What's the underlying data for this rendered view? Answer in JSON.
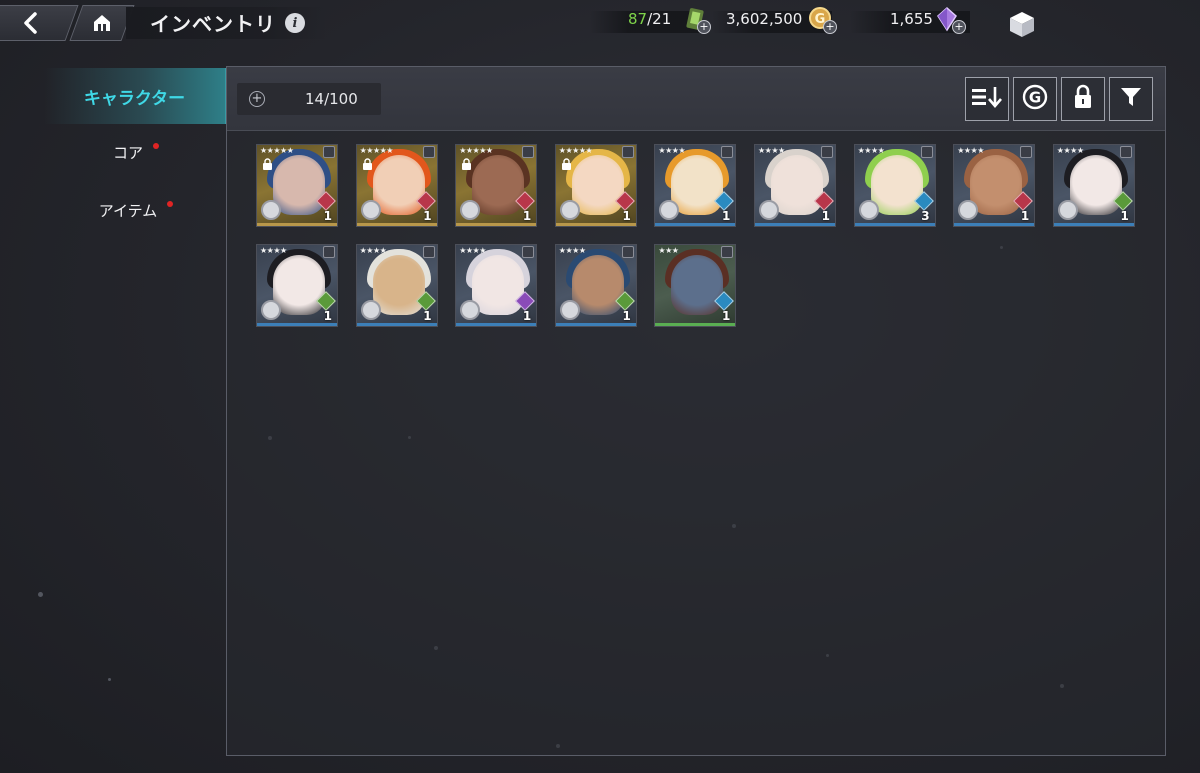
{
  "header": {
    "title": "インベントリ",
    "info_icon": "i",
    "stamina": {
      "current": "87",
      "max": "/21"
    },
    "gold": "3,602,500",
    "gems": "1,655"
  },
  "sidebar": {
    "items": [
      {
        "label": "キャラクター",
        "active": true
      },
      {
        "label": "コア",
        "notify": true
      },
      {
        "label": "アイテム",
        "notify": true
      }
    ]
  },
  "panel": {
    "count": "14/100",
    "tools": [
      "sort-icon",
      "gold-sell-icon",
      "lock-icon",
      "filter-icon"
    ]
  },
  "colors": {
    "accent": "#3fd8e6",
    "notify_dot": "#e02424",
    "stamina_green": "#7ed34a"
  },
  "characters": [
    {
      "stars": "★★★★★",
      "level": "1",
      "locked": true,
      "frame": "gold",
      "hair": "#2f4f86",
      "skin": "#d7b8ad",
      "gem": "#b8364a",
      "badge": "shield-heart"
    },
    {
      "stars": "★★★★★",
      "level": "1",
      "locked": true,
      "frame": "gold",
      "hair": "#e2571c",
      "skin": "#f1cfb6",
      "gem": "#b8364a",
      "badge": "compass"
    },
    {
      "stars": "★★★★★",
      "level": "1",
      "locked": true,
      "frame": "gold",
      "hair": "#5a3322",
      "skin": "#9c6a53",
      "gem": "#b8364a",
      "badge": "shield-heart"
    },
    {
      "stars": "★★★★★",
      "level": "1",
      "locked": true,
      "frame": "gold",
      "hair": "#e5b647",
      "skin": "#f4d8c2",
      "gem": "#b8364a",
      "badge": "shield-heart"
    },
    {
      "stars": "★★★★",
      "level": "1",
      "locked": false,
      "frame": "blue",
      "hair": "#e79a2b",
      "skin": "#f2e2c8",
      "gem": "#2a8ac0",
      "badge": "fist"
    },
    {
      "stars": "★★★★",
      "level": "1",
      "locked": false,
      "frame": "blue",
      "hair": "#d9d2cc",
      "skin": "#efe1da",
      "gem": "#b8364a",
      "badge": "shield-heart"
    },
    {
      "stars": "★★★★",
      "level": "3",
      "locked": false,
      "frame": "blue",
      "hair": "#8fcf4e",
      "skin": "#f3e2cf",
      "gem": "#2a8ac0",
      "badge": "tower"
    },
    {
      "stars": "★★★★",
      "level": "1",
      "locked": false,
      "frame": "blue",
      "hair": "#9a6243",
      "skin": "#c38f6e",
      "gem": "#b8364a",
      "badge": "compass"
    },
    {
      "stars": "★★★★",
      "level": "1",
      "locked": false,
      "frame": "blue",
      "hair": "#1d1d22",
      "skin": "#f2e8e6",
      "gem": "#5a9a3a",
      "badge": "fist"
    },
    {
      "stars": "★★★★",
      "level": "1",
      "locked": false,
      "frame": "blue",
      "hair": "#1d1d22",
      "skin": "#f2e8e6",
      "gem": "#5a9a3a",
      "badge": "fist"
    },
    {
      "stars": "★★★★",
      "level": "1",
      "locked": false,
      "frame": "blue",
      "hair": "#e3e2dc",
      "skin": "#d8b48a",
      "gem": "#5a9a3a",
      "badge": "shield-heart"
    },
    {
      "stars": "★★★★",
      "level": "1",
      "locked": false,
      "frame": "blue",
      "hair": "#d6d3dc",
      "skin": "#f1e6e4",
      "gem": "#8a4bb8",
      "badge": "shield-heart"
    },
    {
      "stars": "★★★★",
      "level": "1",
      "locked": false,
      "frame": "blue",
      "hair": "#2a4a72",
      "skin": "#b78a6c",
      "gem": "#5a9a3a",
      "badge": "fist"
    },
    {
      "stars": "★★★",
      "level": "1",
      "locked": false,
      "frame": "green",
      "hair": "#5a2f24",
      "skin": "#5c6f8c",
      "gem": "#2a8ac0",
      "badge": "none"
    }
  ]
}
